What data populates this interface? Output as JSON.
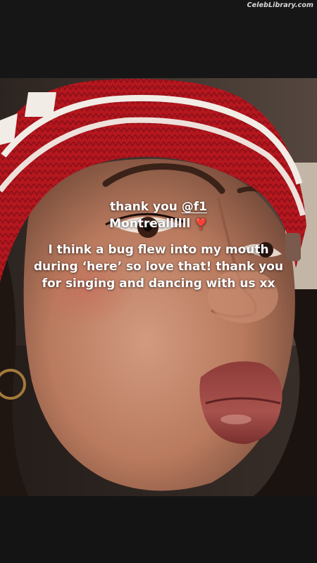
{
  "watermark": {
    "text": "CelebLibrary.com"
  },
  "story": {
    "line1": "thank you",
    "mention": "@f1",
    "line2": "Montreallllll",
    "emoji": "❣️",
    "body": "I think a bug flew into my mouth during ‘here’ so love that! thank you for singing and dancing with us xx"
  },
  "colors": {
    "background": "#161616",
    "beanie_red": "#b5171f",
    "caption_text": "#ffffff"
  }
}
